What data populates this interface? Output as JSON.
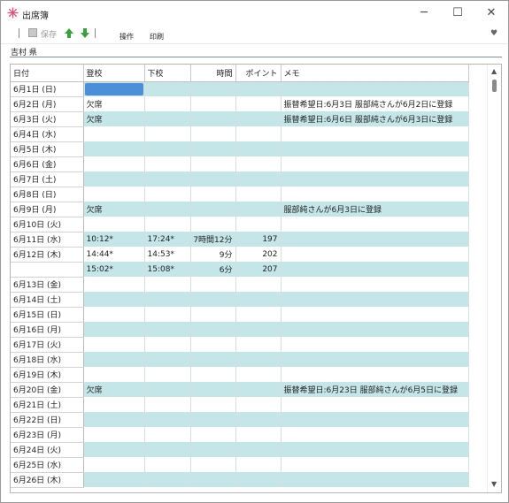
{
  "window": {
    "title": "出席簿",
    "controls": {
      "minimize": "─",
      "maximize": "☐",
      "close": "✕"
    }
  },
  "toolbar": {
    "save_label": "保存",
    "menu_operation": "操作",
    "menu_print": "印刷",
    "heart": "♥"
  },
  "student": {
    "name": "吉村 県"
  },
  "grid": {
    "columns": [
      "日付",
      "登校",
      "下校",
      "時間",
      "ポイント",
      "メモ"
    ],
    "rows": [
      {
        "date": "6月1日 (日)",
        "in": "",
        "out": "",
        "time": "",
        "points": "",
        "memo": "",
        "selected": true
      },
      {
        "date": "6月2日 (月)",
        "in": "欠席",
        "out": "",
        "time": "",
        "points": "",
        "memo": "振替希望日:6月3日 服部純さんが6月2日に登録"
      },
      {
        "date": "6月3日 (火)",
        "in": "欠席",
        "out": "",
        "time": "",
        "points": "",
        "memo": "振替希望日:6月6日 服部純さんが6月3日に登録"
      },
      {
        "date": "6月4日 (水)",
        "in": "",
        "out": "",
        "time": "",
        "points": "",
        "memo": ""
      },
      {
        "date": "6月5日 (木)",
        "in": "",
        "out": "",
        "time": "",
        "points": "",
        "memo": ""
      },
      {
        "date": "6月6日 (金)",
        "in": "",
        "out": "",
        "time": "",
        "points": "",
        "memo": ""
      },
      {
        "date": "6月7日 (土)",
        "in": "",
        "out": "",
        "time": "",
        "points": "",
        "memo": ""
      },
      {
        "date": "6月8日 (日)",
        "in": "",
        "out": "",
        "time": "",
        "points": "",
        "memo": ""
      },
      {
        "date": "6月9日 (月)",
        "in": "欠席",
        "out": "",
        "time": "",
        "points": "",
        "memo": "服部純さんが6月3日に登録"
      },
      {
        "date": "6月10日 (火)",
        "in": "",
        "out": "",
        "time": "",
        "points": "",
        "memo": ""
      },
      {
        "date": "6月11日 (水)",
        "in": "10:12*",
        "out": "17:24*",
        "time": "7時間12分",
        "points": "197",
        "memo": ""
      },
      {
        "date": "6月12日 (木)",
        "in": "14:44*",
        "out": "14:53*",
        "time": "9分",
        "points": "202",
        "memo": ""
      },
      {
        "date": "",
        "in": "15:02*",
        "out": "15:08*",
        "time": "6分",
        "points": "207",
        "memo": ""
      },
      {
        "date": "6月13日 (金)",
        "in": "",
        "out": "",
        "time": "",
        "points": "",
        "memo": ""
      },
      {
        "date": "6月14日 (土)",
        "in": "",
        "out": "",
        "time": "",
        "points": "",
        "memo": ""
      },
      {
        "date": "6月15日 (日)",
        "in": "",
        "out": "",
        "time": "",
        "points": "",
        "memo": ""
      },
      {
        "date": "6月16日 (月)",
        "in": "",
        "out": "",
        "time": "",
        "points": "",
        "memo": ""
      },
      {
        "date": "6月17日 (火)",
        "in": "",
        "out": "",
        "time": "",
        "points": "",
        "memo": ""
      },
      {
        "date": "6月18日 (水)",
        "in": "",
        "out": "",
        "time": "",
        "points": "",
        "memo": ""
      },
      {
        "date": "6月19日 (木)",
        "in": "",
        "out": "",
        "time": "",
        "points": "",
        "memo": ""
      },
      {
        "date": "6月20日 (金)",
        "in": "欠席",
        "out": "",
        "time": "",
        "points": "",
        "memo": "振替希望日:6月23日 服部純さんが6月5日に登録"
      },
      {
        "date": "6月21日 (土)",
        "in": "",
        "out": "",
        "time": "",
        "points": "",
        "memo": ""
      },
      {
        "date": "6月22日 (日)",
        "in": "",
        "out": "",
        "time": "",
        "points": "",
        "memo": ""
      },
      {
        "date": "6月23日 (月)",
        "in": "",
        "out": "",
        "time": "",
        "points": "",
        "memo": ""
      },
      {
        "date": "6月24日 (火)",
        "in": "",
        "out": "",
        "time": "",
        "points": "",
        "memo": ""
      },
      {
        "date": "6月25日 (水)",
        "in": "",
        "out": "",
        "time": "",
        "points": "",
        "memo": ""
      },
      {
        "date": "6月26日 (木)",
        "in": "",
        "out": "",
        "time": "",
        "points": "",
        "memo": ""
      }
    ]
  },
  "colors": {
    "row_shade": "#c4e6e8",
    "selection": "#4a8fd8",
    "up_arrow": "#3aa040",
    "down_arrow": "#3aa040",
    "app_icon": "#e0507a"
  },
  "icons": {
    "app": "flower-icon",
    "save": "save-icon",
    "up": "up-arrow-icon",
    "down": "down-arrow-icon",
    "heart": "heart-icon"
  },
  "scrollbar": {
    "up": "▲",
    "down": "▼"
  }
}
